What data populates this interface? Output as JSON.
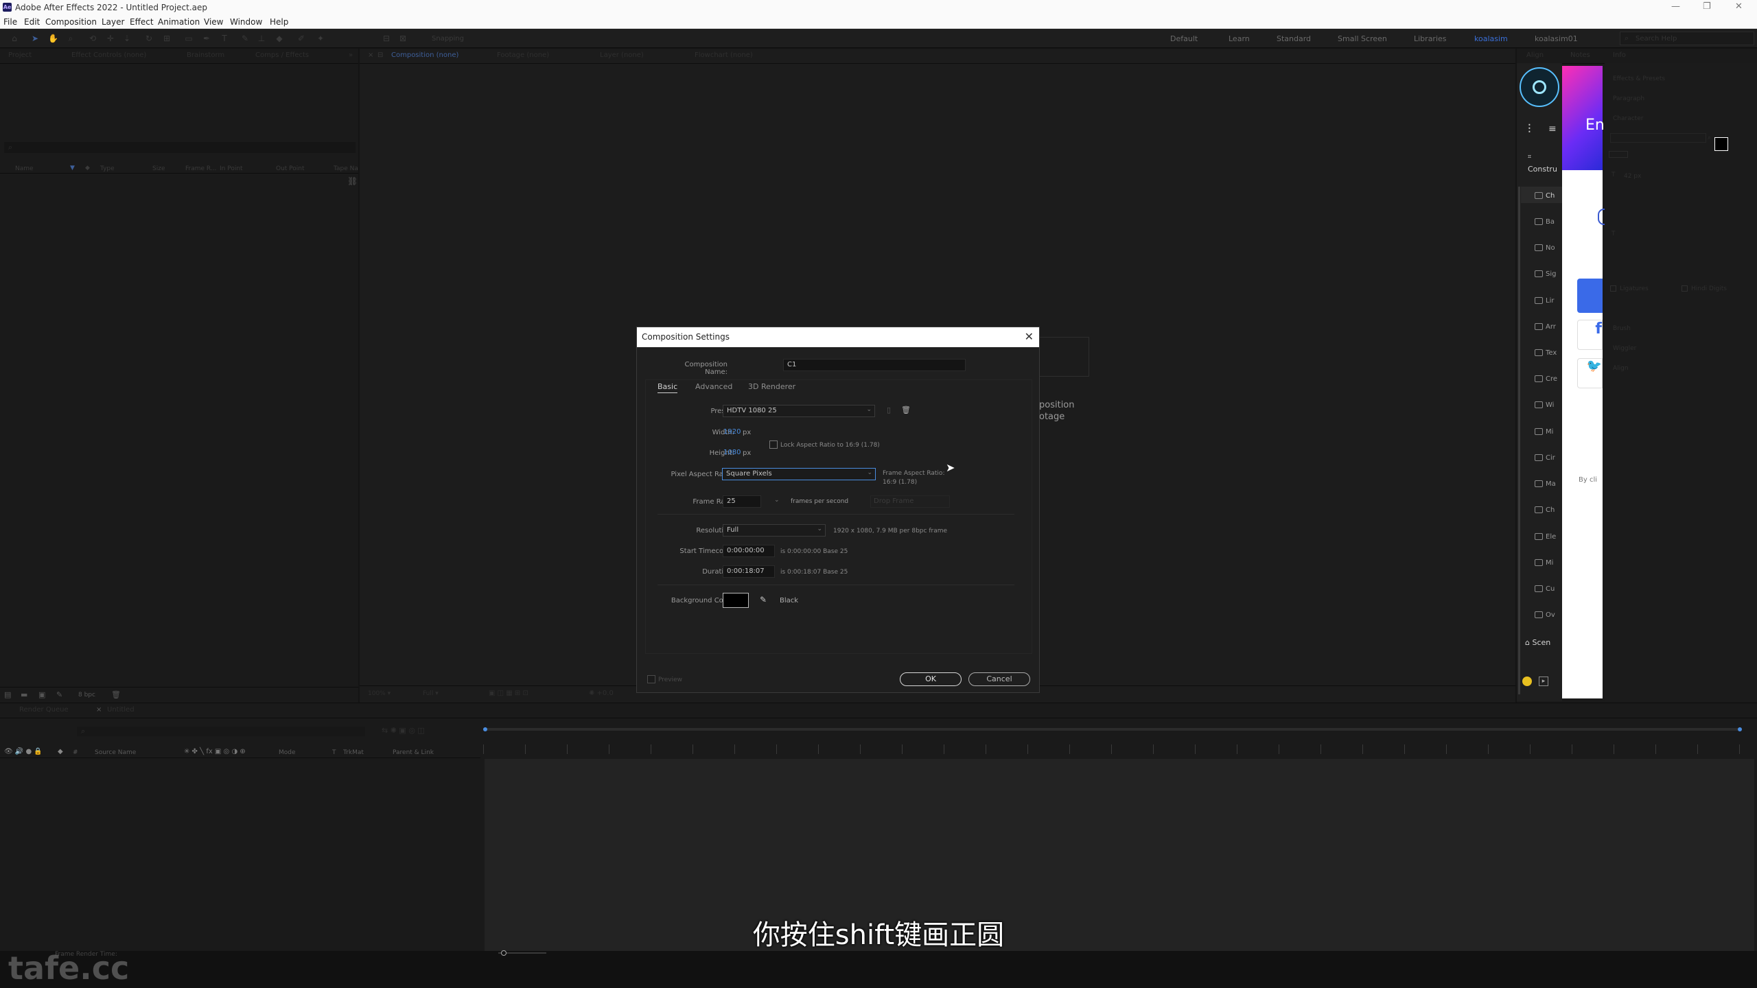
{
  "app": {
    "title": "Adobe After Effects 2022 - Untitled Project.aep",
    "logo": "Ae",
    "window_controls": [
      "—",
      "❐",
      "✕"
    ]
  },
  "menu": [
    "File",
    "Edit",
    "Composition",
    "Layer",
    "Effect",
    "Animation",
    "View",
    "Window",
    "Help"
  ],
  "toolbar": {
    "snapping_label": "Snapping",
    "workspaces": [
      "Default",
      "Learn",
      "Standard",
      "Small Screen",
      "Libraries",
      "koalasim",
      "koalasim01"
    ],
    "active_workspace": "koalasim",
    "search_placeholder": "Search Help"
  },
  "project_panel": {
    "tabs": [
      "Project",
      "Effect Controls (none)",
      "Brainstorm",
      "Comps / Effects"
    ],
    "columns": [
      "Name",
      "Type",
      "Size",
      "Frame R...",
      "In Point",
      "Out Point",
      "Tape Na"
    ],
    "footer_bpc": "8 bpc"
  },
  "viewer": {
    "tabs": [
      "Composition (none)",
      "Footage (none)",
      "Layer (none)",
      "Flowchart (none)"
    ],
    "bg_text_1": "position",
    "bg_text_2": "otage"
  },
  "right_panels": {
    "tabs": [
      "Align",
      "Notes",
      "Info"
    ],
    "items": [
      "Effects & Presets",
      "Paragraph",
      "Character",
      "Brush",
      "Wiggler",
      "Align"
    ],
    "char_size": "42 px",
    "ligatures": "Ligatures",
    "hindi": "Hindi Digits"
  },
  "plugin_panel": {
    "section": "Constru",
    "items": [
      "Ch",
      "Ba",
      "No",
      "Sig",
      "Lir",
      "Arr",
      "Tex",
      "Cre",
      "Wi",
      "Mi",
      "Cir",
      "Ma",
      "Ch",
      "Ele",
      "Mi",
      "Cu",
      "Ov"
    ],
    "scene": "Scen",
    "banner_text": "En",
    "by_text": "By cli"
  },
  "dialog": {
    "title": "Composition Settings",
    "comp_name_label": "Composition Name:",
    "comp_name_value": "C1",
    "tabs": [
      "Basic",
      "Advanced",
      "3D Renderer"
    ],
    "preset_label": "Preset:",
    "preset_value": "HDTV 1080 25",
    "width_label": "Width:",
    "width_value": "1920",
    "height_label": "Height:",
    "height_value": "1080",
    "px": "px",
    "lock_aspect": "Lock Aspect Ratio to 16:9 (1.78)",
    "par_label": "Pixel Aspect Ratio:",
    "par_value": "Square Pixels",
    "frame_aspect_label": "Frame Aspect Ratio:",
    "frame_aspect_value": "16:9 (1.78)",
    "frame_rate_label": "Frame Rate:",
    "frame_rate_value": "25",
    "fps_text": "frames per second",
    "drop_frame": "Drop Frame",
    "resolution_label": "Resolution:",
    "resolution_value": "Full",
    "resolution_info": "1920 x 1080, 7.9 MB per 8bpc frame",
    "start_tc_label": "Start Timecode:",
    "start_tc_value": "0:00:00:00",
    "start_tc_info": "is 0:00:00:00  Base 25",
    "duration_label": "Duration:",
    "duration_value": "0:00:18:07",
    "duration_info": "is 0:00:18:07  Base 25",
    "bg_color_label": "Background Color:",
    "bg_color_name": "Black",
    "bg_color_hex": "#000000",
    "preview_label": "Preview",
    "ok_label": "OK",
    "cancel_label": "Cancel"
  },
  "timeline": {
    "tabs": [
      "Render Queue",
      "Untitled"
    ],
    "columns": [
      "#",
      "Source Name",
      "Mode",
      "T",
      "TrkMat",
      "Parent & Link"
    ],
    "footer": "Frame Render Time:"
  },
  "subtitle": "你按住shift键画正圆",
  "watermark": "tafe.cc"
}
